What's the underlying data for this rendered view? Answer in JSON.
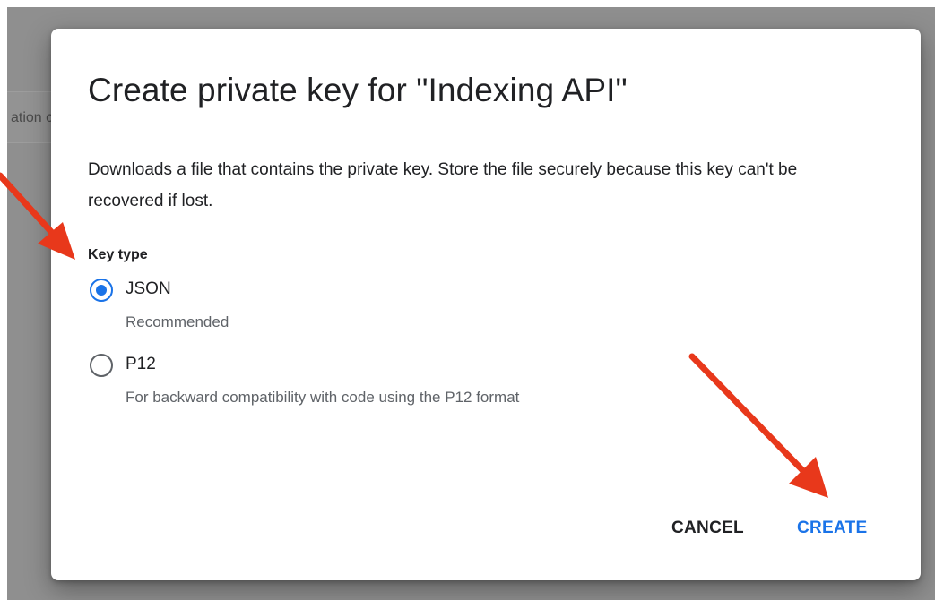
{
  "background": {
    "header_fragment": "ation c"
  },
  "dialog": {
    "title": "Create private key for \"Indexing API\"",
    "description": "Downloads a file that contains the private key. Store the file securely because this key can't be recovered if lost.",
    "key_type_label": "Key type",
    "options": [
      {
        "label": "JSON",
        "description": "Recommended",
        "selected": true
      },
      {
        "label": "P12",
        "description": "For backward compatibility with code using the P12 format",
        "selected": false
      }
    ],
    "buttons": {
      "cancel_label": "CANCEL",
      "create_label": "CREATE"
    }
  },
  "colors": {
    "accent": "#1a73e8",
    "annotation_arrow": "#e8381b",
    "backdrop": "#8f8f8f",
    "text_primary": "#202124",
    "text_secondary": "#5f6368"
  },
  "icons": {
    "radio_selected": "radio-checked-icon",
    "radio_unselected": "radio-unchecked-icon",
    "annotation": "red-arrow-icon"
  }
}
